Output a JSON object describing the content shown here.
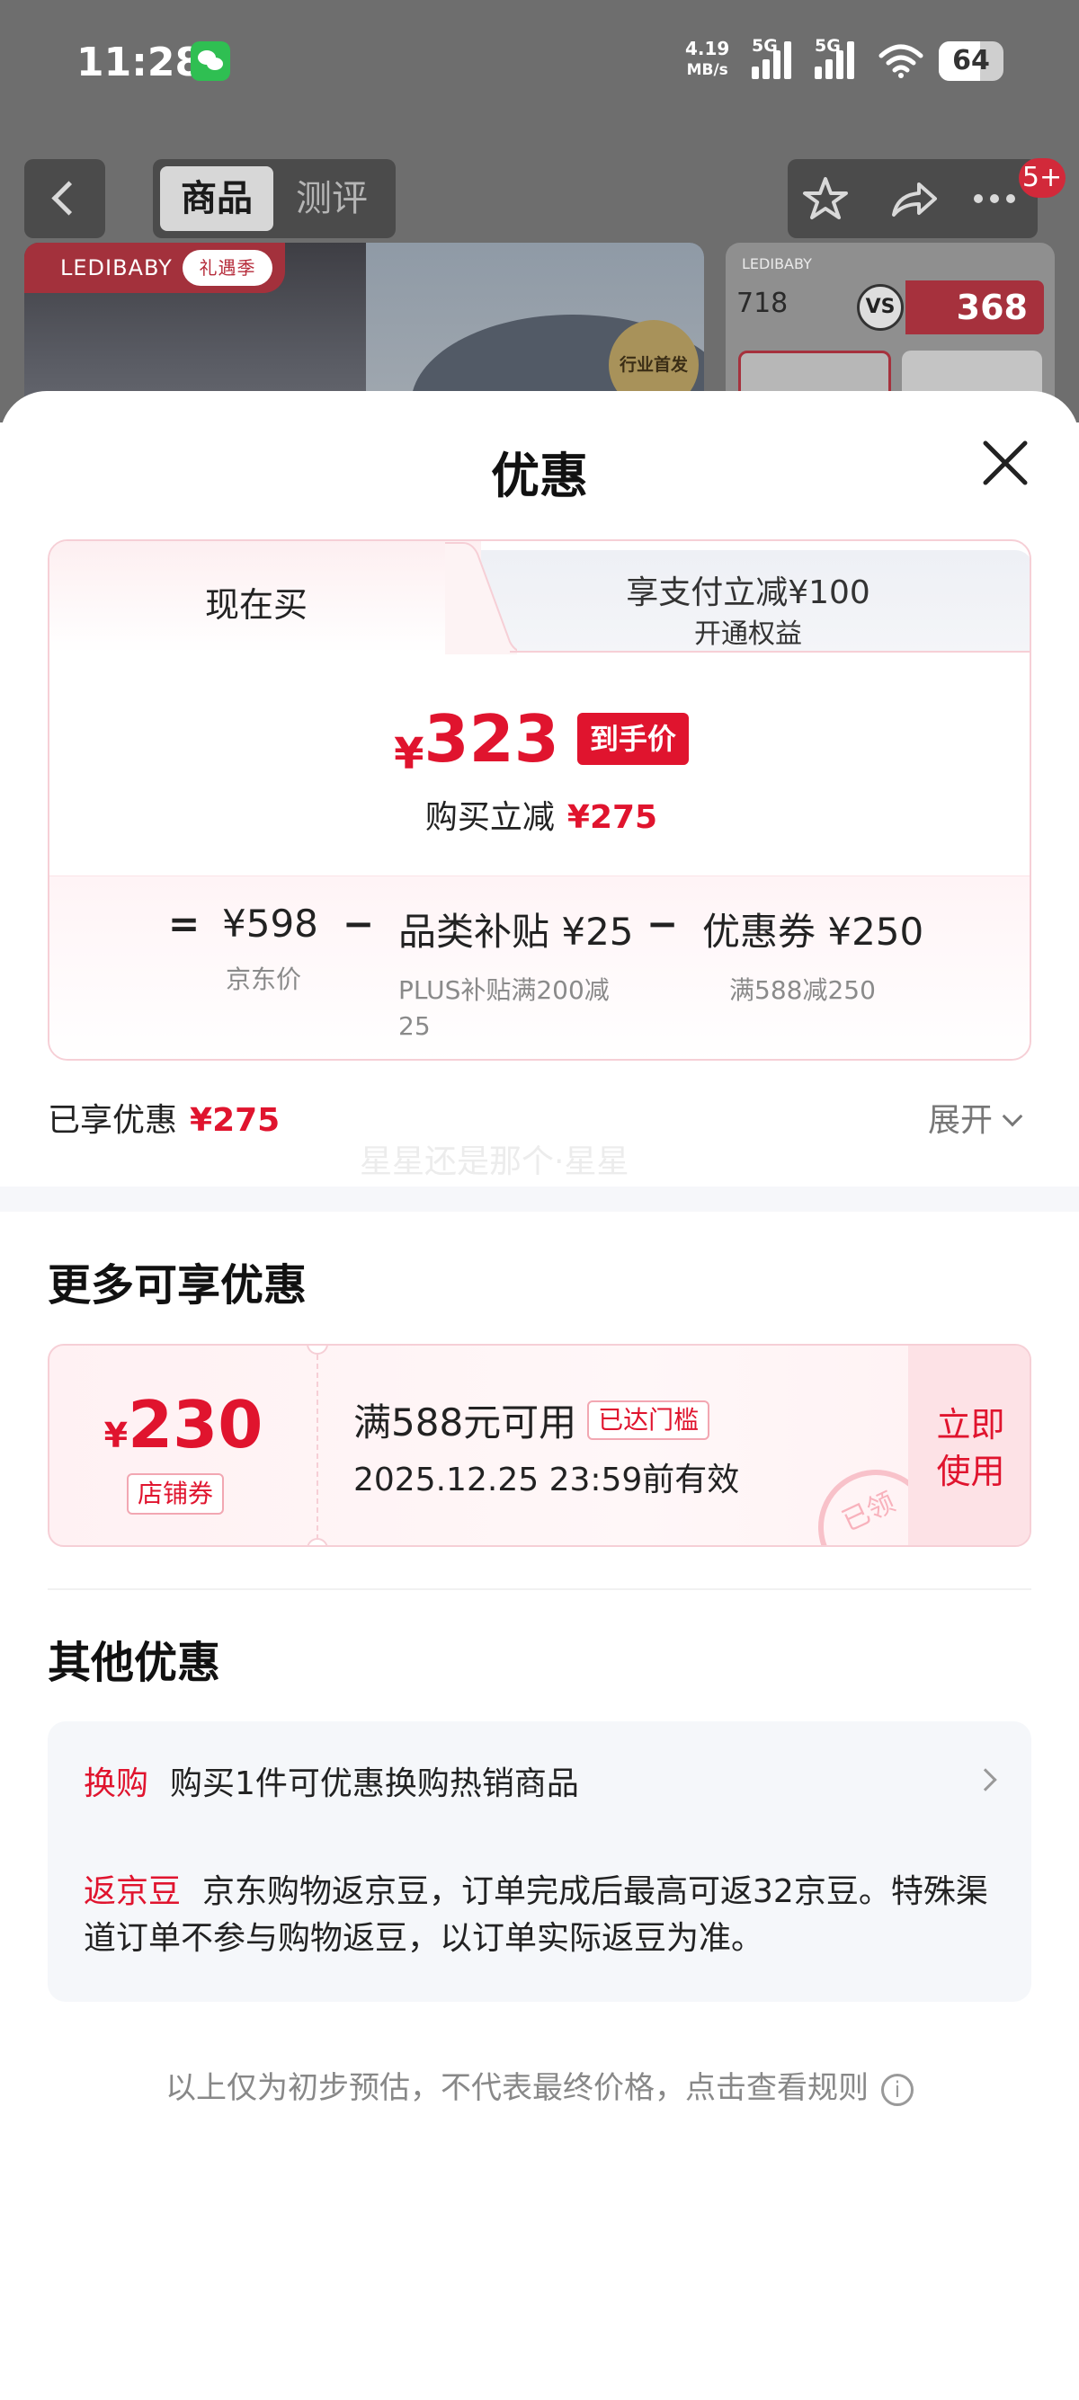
{
  "status_bar": {
    "time": "11:28",
    "net_speed_value": "4.19",
    "net_speed_unit": "MB/s",
    "signal1_label": "5G",
    "signal2_label": "5G",
    "battery": "64"
  },
  "background_page": {
    "tabs": [
      {
        "label": "商品",
        "active": true
      },
      {
        "label": "测评",
        "active": false
      }
    ],
    "badge": "5+",
    "brand": "LEDIBABY",
    "brand_tag": "礼遇季",
    "seal_text": "行业首发",
    "compare_price": "718",
    "vs": "VS",
    "promo_price": "368"
  },
  "sheet": {
    "title": "优惠",
    "tab_now": "现在买",
    "tab_alt_line1": "享支付立减¥100",
    "tab_alt_line2": "开通权益",
    "final_currency": "¥",
    "final_amount": "323",
    "final_tag": "到手价",
    "instant_off_label": "购买立减",
    "instant_off_value": "¥275",
    "breakdown": {
      "eq": "=",
      "minus": "−",
      "jd_price": "¥598",
      "jd_price_label": "京东价",
      "subsidy": "品类补贴 ¥25",
      "subsidy_note": "PLUS补贴满200减25",
      "coupon": "优惠券 ¥250",
      "coupon_note": "满588减250"
    },
    "enjoyed_label": "已享优惠",
    "enjoyed_value": "¥275",
    "expand": "展开",
    "watermark": "星星还是那个·星星",
    "more_title": "更多可享优惠",
    "store_coupon": {
      "currency": "¥",
      "amount": "230",
      "type": "店铺券",
      "condition": "满588元可用",
      "reached": "已达门槛",
      "expiry": "2025.12.25 23:59前有效",
      "use_line1": "立即",
      "use_line2": "使用",
      "stamp": "已领"
    },
    "other_title": "其他优惠",
    "trade_in_label": "换购",
    "trade_in_text": "购买1件可优惠换购热销商品",
    "bean_label": "返京豆",
    "bean_text": "京东购物返京豆，订单完成后最高可返32京豆。特殊渠道订单不参与购物返豆，以订单实际返豆为准。",
    "footer": "以上仅为初步预估，不代表最终价格，点击查看规则"
  },
  "colors": {
    "accent_red": "#e0142e",
    "card_border": "#f6cfd6",
    "muted": "#888888"
  }
}
